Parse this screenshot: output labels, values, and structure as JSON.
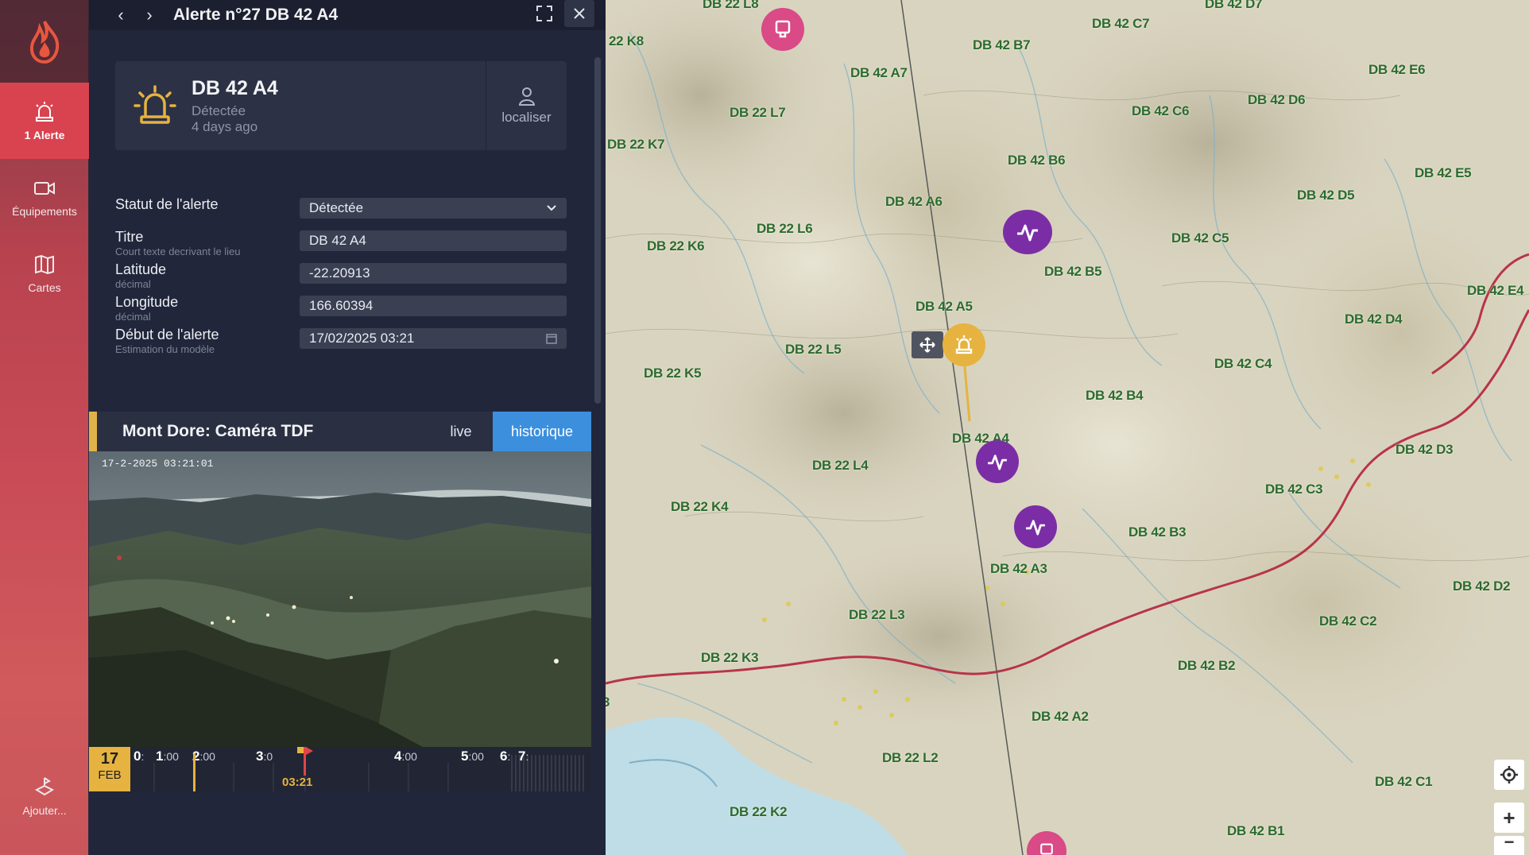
{
  "rail": {
    "items": [
      {
        "label": "1 Alerte",
        "icon": "alert-siren-icon"
      },
      {
        "label": "Équipements",
        "icon": "camera-icon"
      },
      {
        "label": "Cartes",
        "icon": "map-icon"
      },
      {
        "label": "Ajouter...",
        "icon": "add-drone-icon"
      }
    ]
  },
  "header": {
    "title": "Alerte n°27 DB 42 A4"
  },
  "alert": {
    "name": "DB 42 A4",
    "status": "Détectée",
    "age": "4 days ago",
    "locate_label": "localiser"
  },
  "form": {
    "status_label": "Statut de l'alerte",
    "status_value": "Détectée",
    "title_label": "Titre",
    "title_sub": "Court texte decrivant le lieu",
    "title_value": "DB 42 A4",
    "lat_label": "Latitude",
    "lat_sub": "décimal",
    "lat_value": "-22.20913",
    "lon_label": "Longitude",
    "lon_sub": "décimal",
    "lon_value": "166.60394",
    "start_label": "Début de l'alerte",
    "start_sub": "Estimation du modèle",
    "start_value": "17/02/2025 03:21"
  },
  "camera": {
    "title": "Mont Dore: Caméra TDF",
    "tab_live": "live",
    "tab_history": "historique",
    "timestamp": "17-2-2025 03:21:01"
  },
  "timeline": {
    "day": "17",
    "month": "FEB",
    "hours": [
      {
        "h": "0",
        "m": ":"
      },
      {
        "h": "1",
        "m": ":00"
      },
      {
        "h": "2",
        "m": ":00"
      },
      {
        "h": "3",
        "m": ":0"
      },
      {
        "h": "4",
        "m": ":00"
      },
      {
        "h": "5",
        "m": ":00"
      },
      {
        "h": "6",
        "m": ":"
      },
      {
        "h": "7",
        "m": ":"
      }
    ],
    "current": "03:21"
  },
  "map": {
    "labels": [
      "DB 22 L8",
      "DB 42 D7",
      "DB 42 C7",
      "22 K8",
      "DB 42 B7",
      "DB 42 A7",
      "DB 42 E6",
      "DB 42 D6",
      "DB 22 L7",
      "DB 42 C6",
      "DB 22 K7",
      "DB 42 B6",
      "DB 42 E5",
      "DB 42 D5",
      "DB 42 A6",
      "DB 22 L6",
      "DB 42 C5",
      "DB 22 K6",
      "DB 42 B5",
      "DB 42 E4",
      "DB 42 D4",
      "DB 42 A5",
      "DB 22 L5",
      "DB 42 C4",
      "DB 22 K5",
      "DB 42 B4",
      "DB 42 A4",
      "DB 22 L4",
      "DB 42 D3",
      "DB 42 C3",
      "DB 22 K4",
      "DB 42 B3",
      "DB 42 A3",
      "DB 42 D2",
      "DB 22 L3",
      "DB 42 C2",
      "DB 22 K3",
      "DB 42 B2",
      "DB 42 A2",
      "DB 22 L2",
      "DB 42 C1",
      "DB 22 K2",
      "DB 42 B1",
      "3"
    ]
  }
}
